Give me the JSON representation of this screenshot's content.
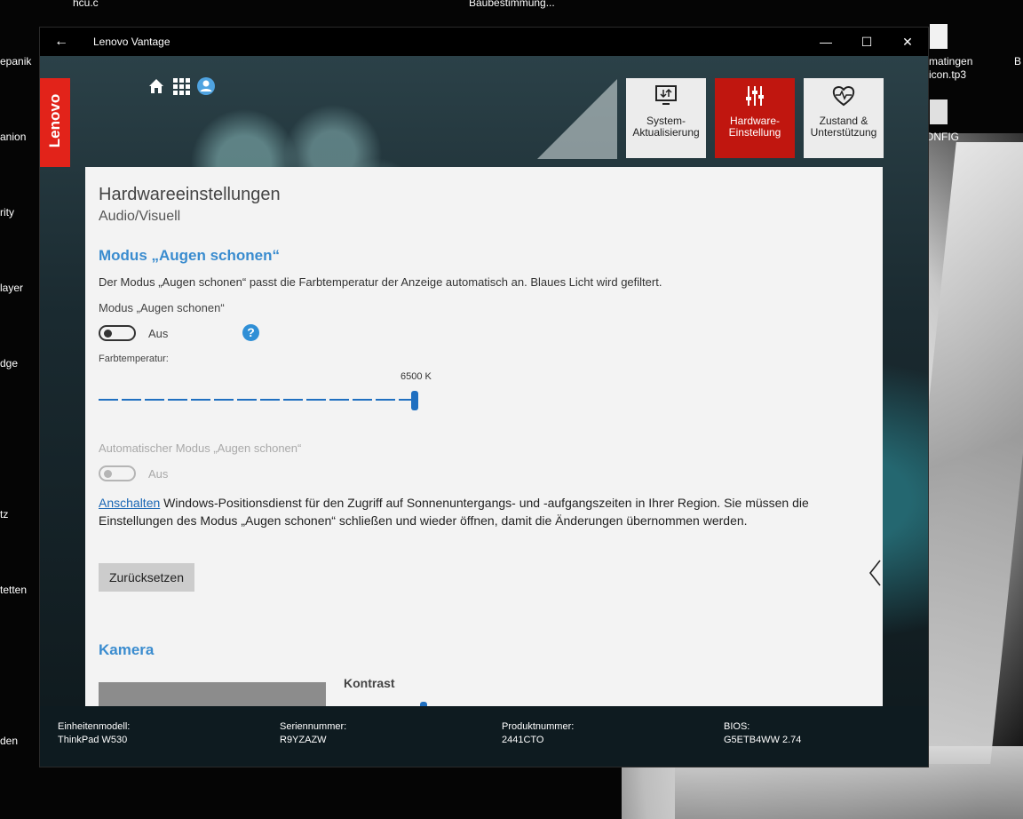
{
  "desktop": {
    "icons": [
      {
        "label": "hcu.c"
      },
      {
        "label": "Baubestimmung..."
      },
      {
        "label": "epanik"
      },
      {
        "label": "anion"
      },
      {
        "label": "rity"
      },
      {
        "label": "layer"
      },
      {
        "label": "dge"
      },
      {
        "label": "tz"
      },
      {
        "label": "tetten"
      },
      {
        "label": "den"
      },
      {
        "label": "matingen"
      },
      {
        "label": "icon.tp3"
      },
      {
        "label": "B"
      },
      {
        "label": "ONFIG"
      }
    ]
  },
  "window": {
    "title": "Lenovo Vantage",
    "controls": {
      "minimize": "—",
      "maximize": "☐",
      "close": "✕"
    },
    "brand": "Lenovo",
    "colors": {
      "accent": "#e2231a",
      "link": "#1a67b5",
      "heading_blue": "#3a8ccf"
    }
  },
  "nav_tiles": [
    {
      "label": "System-Aktualisierung",
      "icon": "monitor-update-icon",
      "active": false
    },
    {
      "label": "Hardware-Einstellung",
      "icon": "sliders-icon",
      "active": true
    },
    {
      "label": "Zustand & Unterstützung",
      "icon": "heart-pulse-icon",
      "active": false
    }
  ],
  "content": {
    "title": "Hardwareeinstellungen",
    "subtitle": "Audio/Visuell",
    "eye_care": {
      "section_title": "Modus „Augen schonen“",
      "description": "Der Modus „Augen schonen“ passt die Farbtemperatur der Anzeige automatisch an. Blaues Licht wird gefiltert.",
      "toggle_label": "Modus „Augen schonen“",
      "toggle_state": "Aus",
      "help": "?",
      "color_temp_label": "Farbtemperatur:",
      "color_temp_value": "6500 K",
      "auto_label": "Automatischer Modus „Augen schonen“",
      "auto_state": "Aus",
      "enable_link": "Anschalten",
      "location_text": " Windows-Positionsdienst für den Zugriff auf Sonnenuntergangs- und -aufgangszeiten in Ihrer Region. Sie müssen die Einstellungen des Modus „Augen schonen“ schließen und wieder öffnen, damit die Änderungen übernommen werden.",
      "reset_button": "Zurücksetzen"
    },
    "camera": {
      "section_title": "Kamera",
      "contrast_label": "Kontrast"
    }
  },
  "footer": {
    "model_label": "Einheitenmodell:",
    "model_value": "ThinkPad W530",
    "serial_label": "Seriennummer:",
    "serial_value": "R9YZAZW",
    "product_label": "Produktnummer:",
    "product_value": "2441CTO",
    "bios_label": "BIOS:",
    "bios_value": "G5ETB4WW 2.74"
  }
}
